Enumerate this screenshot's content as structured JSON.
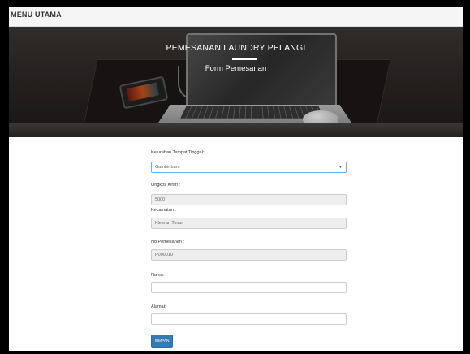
{
  "navbar": {
    "brand": "MENU UTAMA"
  },
  "hero": {
    "title": "PEMESANAN LAUNDRY PELANGI",
    "subtitle": "Form Pemesanan"
  },
  "form": {
    "kelurahan": {
      "label": "Kelurahan Tempat Tinggal:",
      "value": "Gambir baru"
    },
    "ongkos": {
      "label": "Ongkos Kirim :",
      "value": "5000"
    },
    "kecamatan": {
      "label": "Kecamatan :",
      "value": "Kleeran Timur"
    },
    "no_pemesanan": {
      "label": "No Pemesanan :",
      "value": "P000010"
    },
    "nama": {
      "label": "Nama:",
      "value": ""
    },
    "alamat": {
      "label": "Alamat:",
      "value": ""
    },
    "submit_label": "SIMPAN"
  },
  "colors": {
    "primary": "#337ab7",
    "focus_border": "#66afe9",
    "readonly_bg": "#eeeeee"
  },
  "icons": {
    "select_arrow": "chevron-down-icon"
  }
}
